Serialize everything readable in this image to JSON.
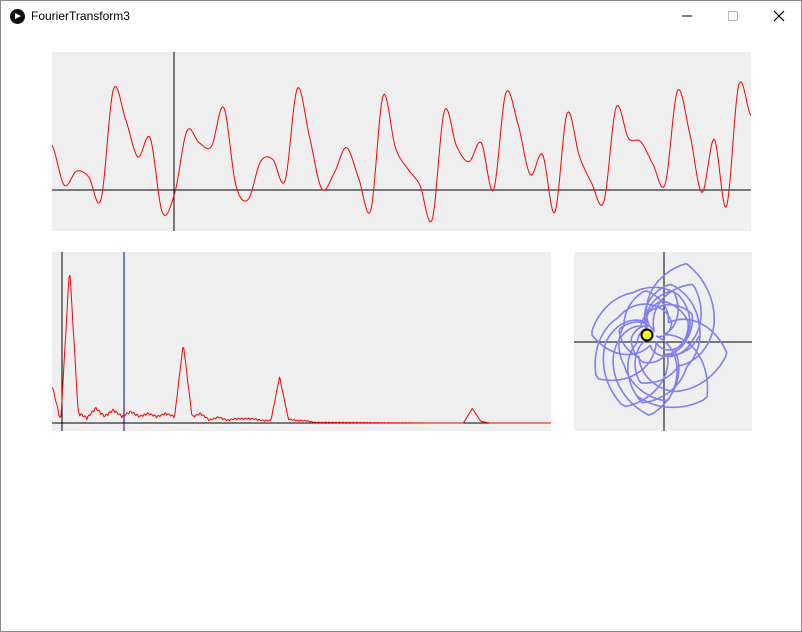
{
  "window": {
    "title": "FourierTransform3",
    "controls": [
      "minimize-icon",
      "maximize-icon",
      "close-icon"
    ]
  },
  "colors": {
    "panel_bg": "#efefef",
    "signal_line": "#ff0000",
    "axis_line": "#000000",
    "marker_line": "#0000aa",
    "polar_curve": "#8080ee",
    "polar_point": "#ffff00"
  },
  "chart_data": [
    {
      "type": "line",
      "series": [
        {
          "values": [
            0.38,
            0.04,
            0.16,
            0.11,
            -0.08,
            0.85,
            0.6,
            0.28,
            0.44,
            -0.19,
            -0.03,
            0.5,
            0.4,
            0.37,
            0.7,
            0.04,
            -0.08,
            0.24,
            0.26,
            0.08,
            0.86,
            0.45,
            0.01,
            0.14,
            0.36,
            0.1,
            -0.17,
            0.8,
            0.36,
            0.18,
            0.04,
            -0.25,
            0.67,
            0.37,
            0.24,
            0.4,
            0.0,
            0.82,
            0.56,
            0.13,
            0.3,
            -0.19,
            0.65,
            0.29,
            0.06,
            -0.1,
            0.7,
            0.44,
            0.41,
            0.22,
            0.05,
            0.84,
            0.48,
            -0.02,
            0.43,
            -0.14,
            0.89,
            0.63
          ],
          "color": "#ff0000"
        }
      ]
    },
    {
      "type": "line",
      "series": [
        {
          "values": [
            0.22,
            0.0,
            0.95,
            0.05,
            0.02,
            0.08,
            0.03,
            0.07,
            0.03,
            0.06,
            0.03,
            0.05,
            0.03,
            0.05,
            0.03,
            0.48,
            0.03,
            0.05,
            0.01,
            0.03,
            0.01,
            0.02,
            0.02,
            0.02,
            0.01,
            0.01,
            0.28,
            0.02,
            0.01,
            0.01,
            0.0,
            0.0,
            0.0,
            0.0,
            0.0,
            0.0,
            0.0,
            0.0,
            0.0,
            0.0,
            0.0,
            0.0,
            0.0,
            0.0,
            0.0,
            0.0,
            0.0,
            0.0,
            0.09,
            0.01,
            0.0,
            0.0,
            0.0,
            0.0,
            0.0,
            0.0,
            0.0,
            0.0
          ],
          "color": "#ff0000"
        }
      ]
    },
    {
      "type": "scatter",
      "series": [
        {
          "name": "",
          "color": "#8080ee",
          "points_polar": "winding of signal around center"
        }
      ],
      "current_point": {
        "x": -0.17,
        "y": 0.07,
        "color": "#ffff00"
      }
    }
  ]
}
